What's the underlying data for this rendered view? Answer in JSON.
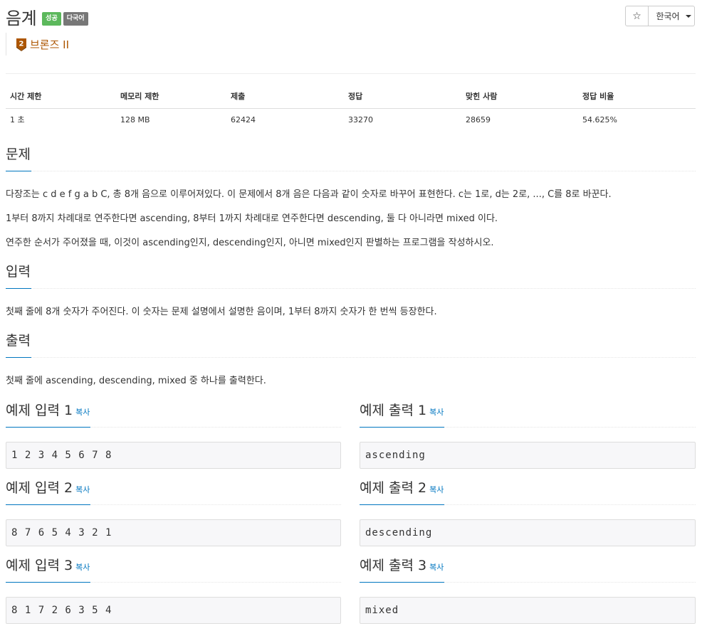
{
  "problem": {
    "title": "음계",
    "badges": {
      "success": "성공",
      "multilang": "다국어"
    },
    "tier": {
      "number": "2",
      "label": "브론즈 II"
    },
    "star": "☆",
    "language": "한국어"
  },
  "info": {
    "headers": [
      "시간 제한",
      "메모리 제한",
      "제출",
      "정답",
      "맞힌 사람",
      "정답 비율"
    ],
    "values": [
      "1 초",
      "128 MB",
      "62424",
      "33270",
      "28659",
      "54.625%"
    ]
  },
  "sections": {
    "description": {
      "title": "문제",
      "paragraphs": [
        "다장조는 c d e f g a b C, 총 8개 음으로 이루어져있다. 이 문제에서 8개 음은 다음과 같이 숫자로 바꾸어 표현한다. c는 1로, d는 2로, ..., C를 8로 바꾼다.",
        "1부터 8까지 차례대로 연주한다면 ascending, 8부터 1까지 차례대로 연주한다면 descending, 둘 다 아니라면 mixed 이다.",
        "연주한 순서가 주어졌을 때, 이것이 ascending인지, descending인지, 아니면 mixed인지 판별하는 프로그램을 작성하시오."
      ]
    },
    "input": {
      "title": "입력",
      "text": "첫째 줄에 8개 숫자가 주어진다. 이 숫자는 문제 설명에서 설명한 음이며, 1부터 8까지 숫자가 한 번씩 등장한다."
    },
    "output": {
      "title": "출력",
      "text": "첫째 줄에 ascending, descending, mixed 중 하나를 출력한다."
    }
  },
  "copy_label": "복사",
  "examples": [
    {
      "input_title": "예제 입력 1",
      "output_title": "예제 출력 1",
      "input": "1 2 3 4 5 6 7 8",
      "output": "ascending"
    },
    {
      "input_title": "예제 입력 2",
      "output_title": "예제 출력 2",
      "input": "8 7 6 5 4 3 2 1",
      "output": "descending"
    },
    {
      "input_title": "예제 입력 3",
      "output_title": "예제 출력 3",
      "input": "8 1 7 2 6 3 5 4",
      "output": "mixed"
    }
  ],
  "colors": {
    "accent": "#0076c0",
    "success": "#5cb85c",
    "multi": "#777777",
    "bronze": "#ad5600"
  }
}
